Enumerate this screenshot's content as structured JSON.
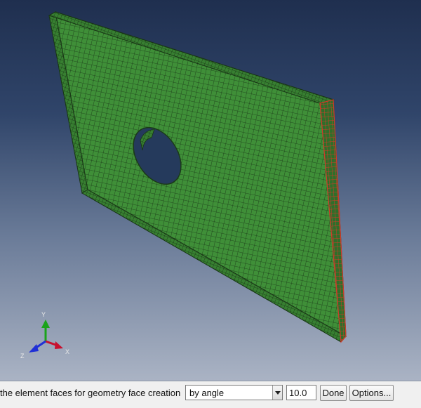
{
  "viewport": {
    "triad": {
      "x_label": "X",
      "y_label": "Y",
      "z_label": "Z",
      "colors": {
        "x": "#c8102e",
        "y": "#1aa31a",
        "z": "#1f2fd6"
      }
    },
    "colors": {
      "mesh_face": "#3f8f38",
      "mesh_lines": "#1b3a18",
      "selected_edge": "#d23a2a"
    }
  },
  "prompt": {
    "text": "the element faces for geometry face creation",
    "method_value": "by angle",
    "angle_value": "10.0",
    "done_label": "Done",
    "options_label": "Options..."
  }
}
